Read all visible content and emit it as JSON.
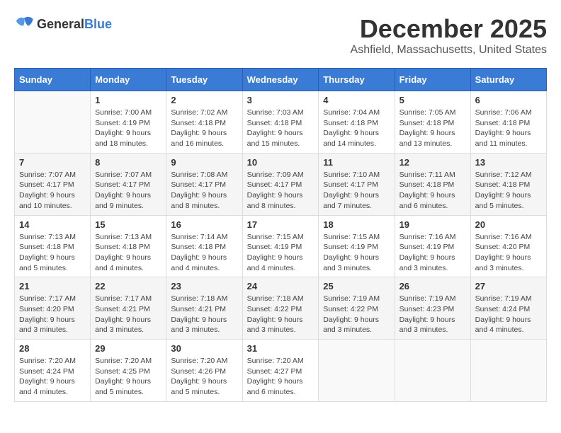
{
  "header": {
    "logo_general": "General",
    "logo_blue": "Blue",
    "month_year": "December 2025",
    "location": "Ashfield, Massachusetts, United States"
  },
  "days_of_week": [
    "Sunday",
    "Monday",
    "Tuesday",
    "Wednesday",
    "Thursday",
    "Friday",
    "Saturday"
  ],
  "weeks": [
    [
      {
        "day": "",
        "info": ""
      },
      {
        "day": "1",
        "info": "Sunrise: 7:00 AM\nSunset: 4:19 PM\nDaylight: 9 hours\nand 18 minutes."
      },
      {
        "day": "2",
        "info": "Sunrise: 7:02 AM\nSunset: 4:18 PM\nDaylight: 9 hours\nand 16 minutes."
      },
      {
        "day": "3",
        "info": "Sunrise: 7:03 AM\nSunset: 4:18 PM\nDaylight: 9 hours\nand 15 minutes."
      },
      {
        "day": "4",
        "info": "Sunrise: 7:04 AM\nSunset: 4:18 PM\nDaylight: 9 hours\nand 14 minutes."
      },
      {
        "day": "5",
        "info": "Sunrise: 7:05 AM\nSunset: 4:18 PM\nDaylight: 9 hours\nand 13 minutes."
      },
      {
        "day": "6",
        "info": "Sunrise: 7:06 AM\nSunset: 4:18 PM\nDaylight: 9 hours\nand 11 minutes."
      }
    ],
    [
      {
        "day": "7",
        "info": "Sunrise: 7:07 AM\nSunset: 4:17 PM\nDaylight: 9 hours\nand 10 minutes."
      },
      {
        "day": "8",
        "info": "Sunrise: 7:07 AM\nSunset: 4:17 PM\nDaylight: 9 hours\nand 9 minutes."
      },
      {
        "day": "9",
        "info": "Sunrise: 7:08 AM\nSunset: 4:17 PM\nDaylight: 9 hours\nand 8 minutes."
      },
      {
        "day": "10",
        "info": "Sunrise: 7:09 AM\nSunset: 4:17 PM\nDaylight: 9 hours\nand 8 minutes."
      },
      {
        "day": "11",
        "info": "Sunrise: 7:10 AM\nSunset: 4:17 PM\nDaylight: 9 hours\nand 7 minutes."
      },
      {
        "day": "12",
        "info": "Sunrise: 7:11 AM\nSunset: 4:18 PM\nDaylight: 9 hours\nand 6 minutes."
      },
      {
        "day": "13",
        "info": "Sunrise: 7:12 AM\nSunset: 4:18 PM\nDaylight: 9 hours\nand 5 minutes."
      }
    ],
    [
      {
        "day": "14",
        "info": "Sunrise: 7:13 AM\nSunset: 4:18 PM\nDaylight: 9 hours\nand 5 minutes."
      },
      {
        "day": "15",
        "info": "Sunrise: 7:13 AM\nSunset: 4:18 PM\nDaylight: 9 hours\nand 4 minutes."
      },
      {
        "day": "16",
        "info": "Sunrise: 7:14 AM\nSunset: 4:18 PM\nDaylight: 9 hours\nand 4 minutes."
      },
      {
        "day": "17",
        "info": "Sunrise: 7:15 AM\nSunset: 4:19 PM\nDaylight: 9 hours\nand 4 minutes."
      },
      {
        "day": "18",
        "info": "Sunrise: 7:15 AM\nSunset: 4:19 PM\nDaylight: 9 hours\nand 3 minutes."
      },
      {
        "day": "19",
        "info": "Sunrise: 7:16 AM\nSunset: 4:19 PM\nDaylight: 9 hours\nand 3 minutes."
      },
      {
        "day": "20",
        "info": "Sunrise: 7:16 AM\nSunset: 4:20 PM\nDaylight: 9 hours\nand 3 minutes."
      }
    ],
    [
      {
        "day": "21",
        "info": "Sunrise: 7:17 AM\nSunset: 4:20 PM\nDaylight: 9 hours\nand 3 minutes."
      },
      {
        "day": "22",
        "info": "Sunrise: 7:17 AM\nSunset: 4:21 PM\nDaylight: 9 hours\nand 3 minutes."
      },
      {
        "day": "23",
        "info": "Sunrise: 7:18 AM\nSunset: 4:21 PM\nDaylight: 9 hours\nand 3 minutes."
      },
      {
        "day": "24",
        "info": "Sunrise: 7:18 AM\nSunset: 4:22 PM\nDaylight: 9 hours\nand 3 minutes."
      },
      {
        "day": "25",
        "info": "Sunrise: 7:19 AM\nSunset: 4:22 PM\nDaylight: 9 hours\nand 3 minutes."
      },
      {
        "day": "26",
        "info": "Sunrise: 7:19 AM\nSunset: 4:23 PM\nDaylight: 9 hours\nand 3 minutes."
      },
      {
        "day": "27",
        "info": "Sunrise: 7:19 AM\nSunset: 4:24 PM\nDaylight: 9 hours\nand 4 minutes."
      }
    ],
    [
      {
        "day": "28",
        "info": "Sunrise: 7:20 AM\nSunset: 4:24 PM\nDaylight: 9 hours\nand 4 minutes."
      },
      {
        "day": "29",
        "info": "Sunrise: 7:20 AM\nSunset: 4:25 PM\nDaylight: 9 hours\nand 5 minutes."
      },
      {
        "day": "30",
        "info": "Sunrise: 7:20 AM\nSunset: 4:26 PM\nDaylight: 9 hours\nand 5 minutes."
      },
      {
        "day": "31",
        "info": "Sunrise: 7:20 AM\nSunset: 4:27 PM\nDaylight: 9 hours\nand 6 minutes."
      },
      {
        "day": "",
        "info": ""
      },
      {
        "day": "",
        "info": ""
      },
      {
        "day": "",
        "info": ""
      }
    ]
  ]
}
